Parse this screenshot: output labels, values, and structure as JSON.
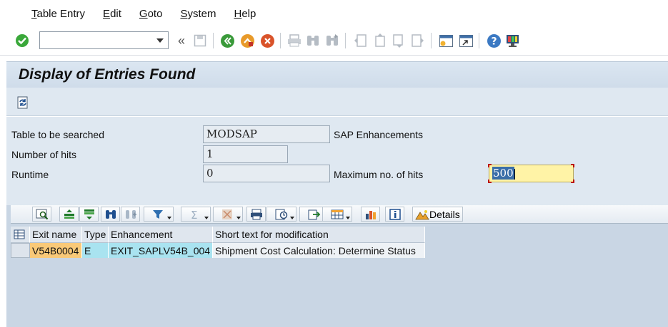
{
  "menu": {
    "items": [
      {
        "ul": "T",
        "rest": "able Entry"
      },
      {
        "ul": "E",
        "rest": "dit"
      },
      {
        "ul": "G",
        "rest": "oto"
      },
      {
        "ul": "S",
        "rest": "ystem"
      },
      {
        "ul": "H",
        "rest": "elp"
      }
    ]
  },
  "toolbar": {
    "command_value": "",
    "icons": [
      "enter-icon",
      "back-icon",
      "exit-icon",
      "cancel-icon",
      "print-icon",
      "find-icon",
      "find-next-icon",
      "first-page-icon",
      "previous-page-icon",
      "next-page-icon",
      "last-page-icon",
      "new-session-icon",
      "shortcut-icon",
      "help-icon",
      "customize-layout-icon"
    ]
  },
  "title": "Display of Entries Found",
  "form": {
    "table_label": "Table to be searched",
    "table_value": "MODSAP",
    "table_desc": "SAP Enhancements",
    "hits_label": "Number of hits",
    "hits_value": "1",
    "runtime_label": "Runtime",
    "runtime_value": "0",
    "max_hits_label": "Maximum no. of hits",
    "max_hits_value": "500"
  },
  "alv": {
    "details_label": "Details",
    "columns": [
      "Exit name",
      "Type",
      "Enhancement",
      "Short text for modification"
    ],
    "rows": [
      [
        "V54B0004",
        "E",
        "EXIT_SAPLV54B_004",
        "Shipment Cost Calculation: Determine Status"
      ]
    ]
  },
  "colors": {
    "key_cell": "#f9c978",
    "value_cell": "#a9e3f0",
    "text_cell": "#eef2f6",
    "enter_green": "#3aa83a",
    "back_green": "#3a9a3a",
    "exit_orange": "#e89a2a",
    "cancel_red": "#d9532a"
  }
}
